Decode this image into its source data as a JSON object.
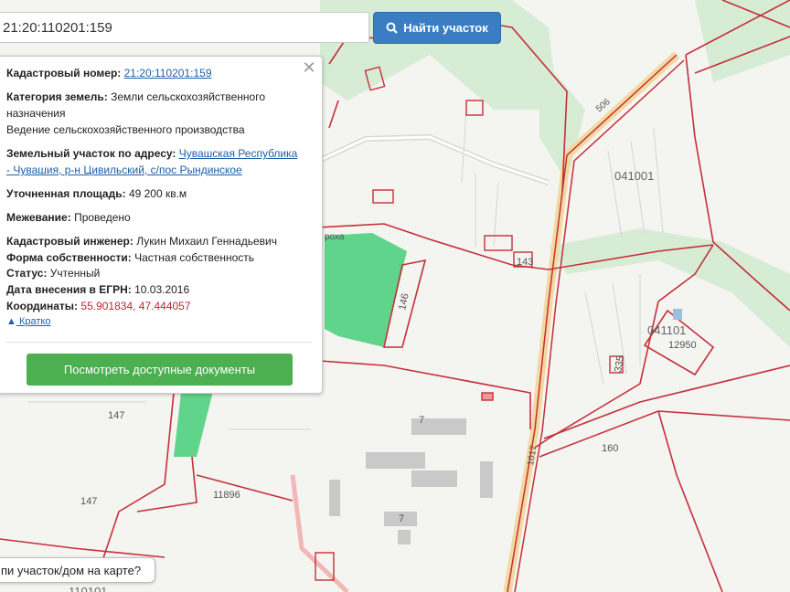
{
  "search": {
    "value": "21:20:110201:159",
    "button_label": "Найти участок"
  },
  "popup": {
    "cadastral_label": "Кадастровый номер:",
    "cadastral_value": "21:20:110201:159",
    "category_label": "Категория земель:",
    "category_line1": "Земли сельскохозяйственного",
    "category_line2": "назначения",
    "category_line3": "Ведение сельскохозяйственного производства",
    "address_label": "Земельный участок по адресу:",
    "address_part1": "Чувашская Республика",
    "address_part2": "- Чувашия, р-н Цивильский, с/пос Рындинское",
    "area_label": "Уточненная площадь:",
    "area_value": "49 200 кв.м",
    "survey_label": "Межевание:",
    "survey_value": "Проведено",
    "engineer_label": "Кадастровый инженер:",
    "engineer_value": "Лукин Михаил Геннадьевич",
    "ownership_label": "Форма собственности:",
    "ownership_value": "Частная собственность",
    "status_label": "Статус:",
    "status_value": "Учтенный",
    "date_label": "Дата внесения в ЕГРН:",
    "date_value": "10.03.2016",
    "coords_label": "Координаты:",
    "coords_value": "55.901834, 47.444057",
    "brief_link": "Кратко",
    "docs_button": "Посмотреть доступные документы"
  },
  "map": {
    "labels": {
      "l041001": "041001",
      "l041101": "041101",
      "l12950": "12950",
      "l160": "160",
      "l147a": "147",
      "l147b": "147",
      "l11896": "11896",
      "l7a": "7",
      "l7b": "7",
      "l146": "146",
      "l143": "143",
      "l335": "335",
      "l506": "506",
      "l1017": "1017",
      "l110101": "110101",
      "lroad": "роха"
    }
  },
  "hint_text": "пи участок/дом на карте?",
  "colors": {
    "parcel_line": "#c62f3a",
    "green": "#5fd48a",
    "road": "#f3d9a0",
    "button_blue": "#3a7dc3",
    "button_green": "#4caf50"
  }
}
